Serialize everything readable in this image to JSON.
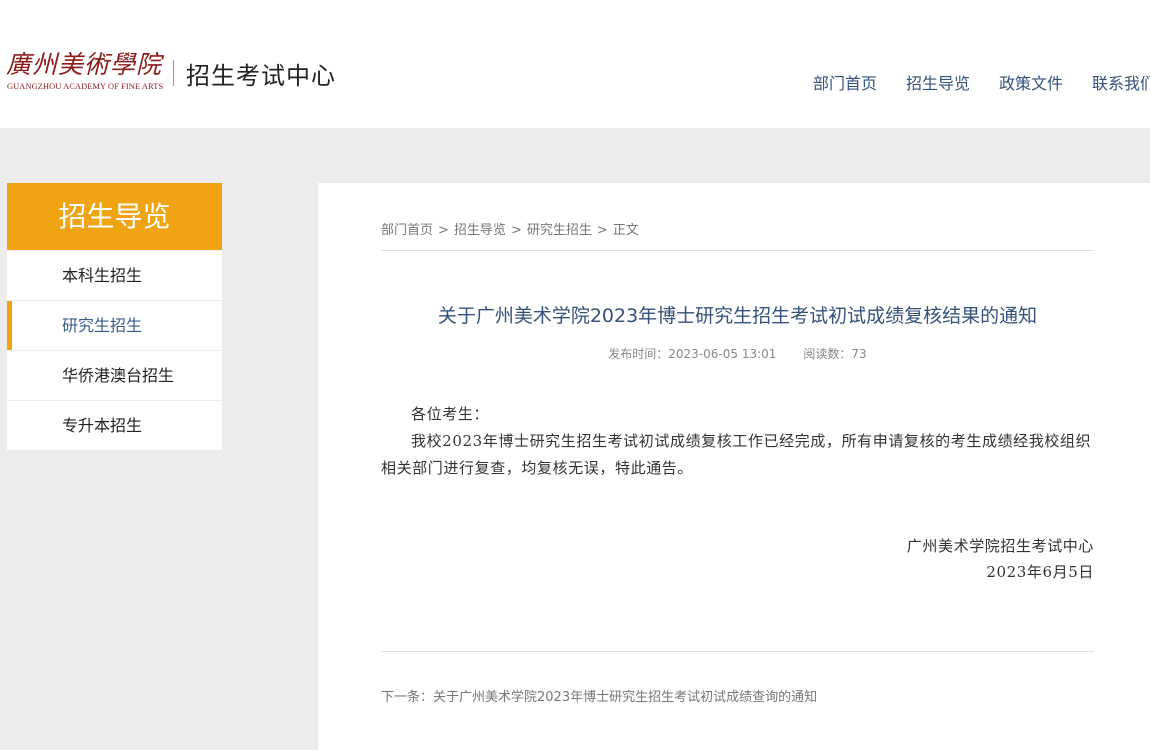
{
  "header": {
    "logo_script": "廣州美術學院",
    "logo_en": "GUANGZHOU ACADEMY OF FINE ARTS",
    "site_title": "招生考试中心",
    "nav": [
      "部门首页",
      "招生导览",
      "政策文件",
      "联系我们"
    ]
  },
  "sidebar": {
    "title": "招生导览",
    "items": [
      {
        "label": "本科生招生",
        "active": false
      },
      {
        "label": "研究生招生",
        "active": true
      },
      {
        "label": "华侨港澳台招生",
        "active": false
      },
      {
        "label": "专升本招生",
        "active": false
      }
    ]
  },
  "article": {
    "breadcrumb": [
      "部门首页",
      "招生导览",
      "研究生招生",
      "正文"
    ],
    "breadcrumb_sep": ">",
    "title": "关于广州美术学院2023年博士研究生招生考试初试成绩复核结果的通知",
    "publish_time": "发布时间：2023-06-05 13:01",
    "read_count": "阅读数：73",
    "greeting": "各位考生：",
    "body": "我校2023年博士研究生招生考试初试成绩复核工作已经完成，所有申请复核的考生成绩经我校组织相关部门进行复查，均复核无误，特此通告。",
    "signature_org": "广州美术学院招生考试中心",
    "signature_date": "2023年6月5日",
    "next_label": "下一条：",
    "next_title": "关于广州美术学院2023年博士研究生招生考试初试成绩查询的通知"
  },
  "colors": {
    "accent": "#f0a412",
    "nav_text": "#34527c",
    "logo": "#8e1b1b"
  }
}
